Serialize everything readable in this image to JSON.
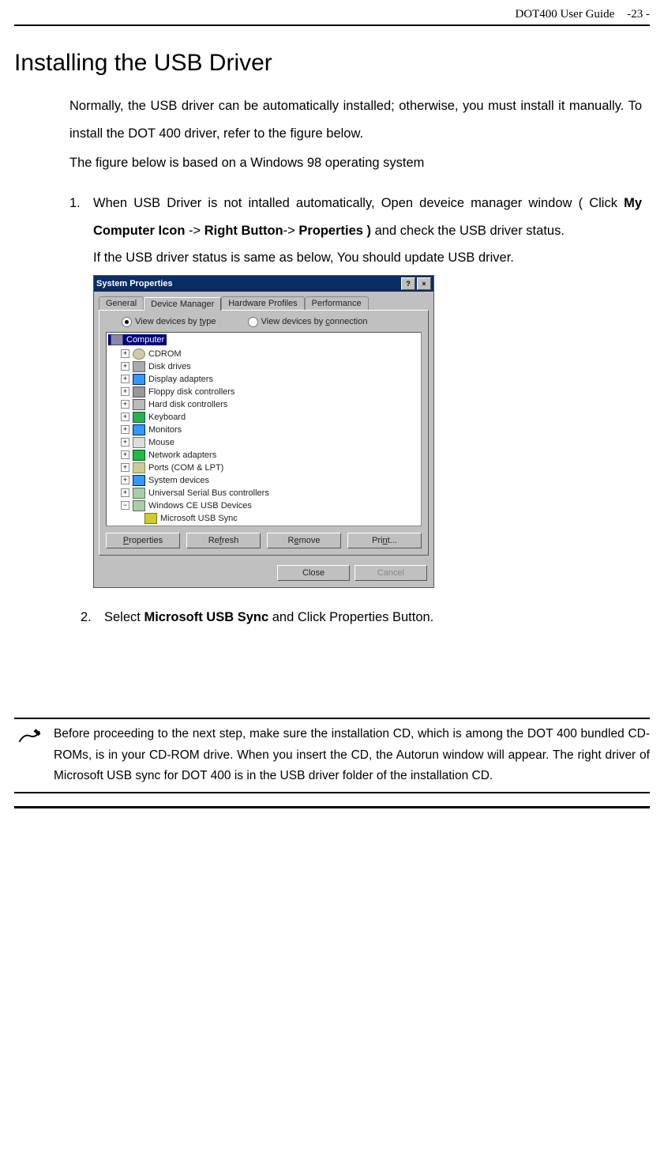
{
  "header": {
    "title": "DOT400 User Guide",
    "page": "-23 -"
  },
  "h1": "Installing the USB Driver",
  "intro1": "Normally, the USB driver can be automatically installed; otherwise, you must install it manually. To install the DOT 400 driver, refer to the figure below.",
  "intro2": "The figure below is based on a Windows 98 operating system",
  "step1": {
    "num": "1.",
    "pre": "When USB Driver is not intalled automatically, Open deveice manager window ( Click ",
    "b1": "My Computer Icon",
    "mid1": " -> ",
    "b2": "Right Button",
    "mid2": "-> ",
    "b3": "Properties )",
    "post": " and check the USB driver status.",
    "line2": "If the USB driver status is same as below, You should update USB driver."
  },
  "dialog": {
    "title": "System Properties",
    "help": "?",
    "close": "×",
    "tabs": [
      "General",
      "Device Manager",
      "Hardware Profiles",
      "Performance"
    ],
    "radio1_pre": "View devices by ",
    "radio1_u": "t",
    "radio1_post": "ype",
    "radio2_pre": "View devices by ",
    "radio2_u": "c",
    "radio2_post": "onnection",
    "tree": {
      "root": "Computer",
      "items": [
        {
          "exp": "+",
          "ico": "ico-cd",
          "label": "CDROM"
        },
        {
          "exp": "+",
          "ico": "ico-disk",
          "label": "Disk drives"
        },
        {
          "exp": "+",
          "ico": "ico-monitor",
          "label": "Display adapters"
        },
        {
          "exp": "+",
          "ico": "ico-floppy",
          "label": "Floppy disk controllers"
        },
        {
          "exp": "+",
          "ico": "ico-hdd",
          "label": "Hard disk controllers"
        },
        {
          "exp": "+",
          "ico": "ico-kb",
          "label": "Keyboard"
        },
        {
          "exp": "+",
          "ico": "ico-mon2",
          "label": "Monitors"
        },
        {
          "exp": "+",
          "ico": "ico-mouse",
          "label": "Mouse"
        },
        {
          "exp": "+",
          "ico": "ico-net",
          "label": "Network adapters"
        },
        {
          "exp": "+",
          "ico": "ico-port",
          "label": "Ports (COM & LPT)"
        },
        {
          "exp": "+",
          "ico": "ico-sys",
          "label": "System devices"
        },
        {
          "exp": "+",
          "ico": "ico-usb",
          "label": "Universal Serial Bus controllers"
        },
        {
          "exp": "−",
          "ico": "ico-wince",
          "label": "Windows CE USB Devices"
        }
      ],
      "child": {
        "ico": "ico-sync",
        "label": "Microsoft USB Sync"
      }
    },
    "btns": {
      "properties_u": "P",
      "properties": "roperties",
      "refresh_pre": "Re",
      "refresh_u": "f",
      "refresh_post": "resh",
      "remove_pre": "R",
      "remove_u": "e",
      "remove_post": "move",
      "print_pre": "Pri",
      "print_u": "n",
      "print_post": "t..."
    },
    "close_btn": "Close",
    "cancel_btn": "Cancel"
  },
  "step2": {
    "num": "2.",
    "pre": "Select ",
    "b": "Microsoft USB Sync",
    "post": " and Click Properties Button."
  },
  "note": "Before proceeding to the next step, make sure the installation CD, which is among the DOT 400 bundled CD-ROMs, is in your CD-ROM drive. When you insert the CD, the Autorun window will appear. The right driver of Microsoft USB sync for DOT 400 is in the USB driver folder of the installation CD."
}
